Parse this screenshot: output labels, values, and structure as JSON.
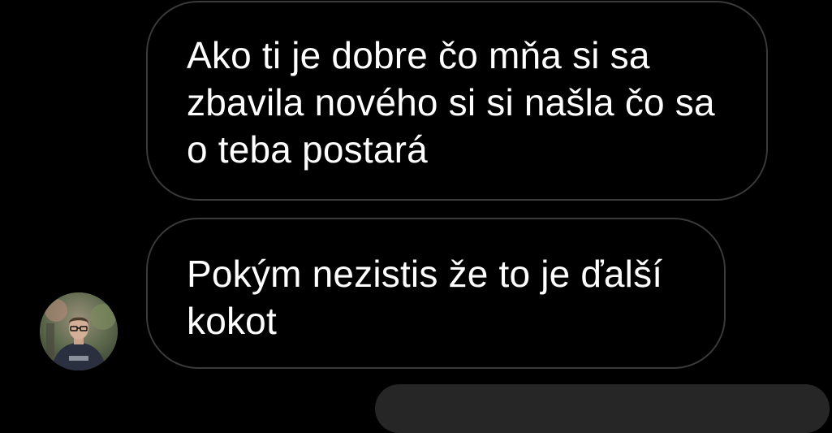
{
  "messages": [
    {
      "text": "Ako ti je dobre čo mňa si sa\nzbavila nového si si našla čo sa\no teba postará"
    },
    {
      "text": "Pokým nezistis že to je ďalší\nkokot"
    }
  ],
  "colors": {
    "background": "#000000",
    "bubble_border": "#3a3a3a",
    "text": "#ffffff",
    "outgoing_bubble": "#262626"
  },
  "icons": {
    "avatar": "avatar-photo"
  }
}
